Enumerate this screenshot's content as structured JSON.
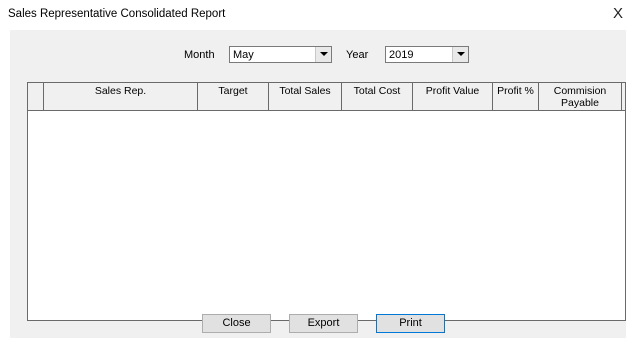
{
  "window": {
    "title": "Sales Representative Consolidated Report",
    "close_glyph": "X"
  },
  "filters": {
    "month_label": "Month",
    "month_value": "May",
    "year_label": "Year",
    "year_value": "2019"
  },
  "grid": {
    "columns": [
      "Sales Rep.",
      "Target",
      "Total Sales",
      "Total Cost",
      "Profit Value",
      "Profit %",
      "Commision Payable"
    ],
    "rows": []
  },
  "buttons": {
    "close": "Close",
    "export": "Export",
    "print": "Print"
  }
}
